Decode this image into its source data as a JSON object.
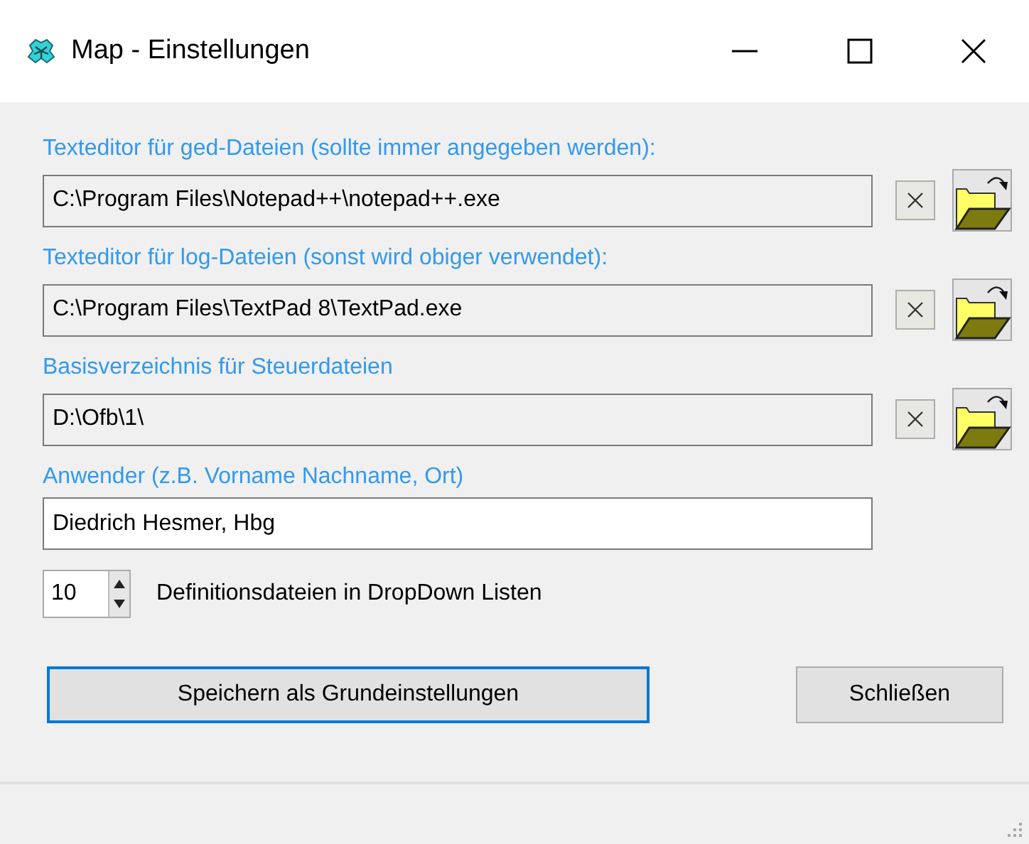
{
  "window": {
    "title": "Map - Einstellungen"
  },
  "path_fields": [
    {
      "label": "Texteditor für ged-Dateien (sollte immer angegeben werden):",
      "value": "C:\\Program Files\\Notepad++\\notepad++.exe",
      "readonly": true,
      "browse": true
    },
    {
      "label": "Texteditor für log-Dateien (sonst wird obiger verwendet):",
      "value": "C:\\Program Files\\TextPad 8\\TextPad.exe",
      "readonly": true,
      "browse": true
    },
    {
      "label": "Basisverzeichnis für Steuerdateien",
      "value": "D:\\Ofb\\1\\",
      "readonly": true,
      "browse": true
    },
    {
      "label": "Anwender (z.B. Vorname Nachname, Ort)",
      "value": "Diedrich Hesmer, Hbg",
      "readonly": false,
      "browse": false
    }
  ],
  "spinner": {
    "value": "10",
    "label": "Definitionsdateien in DropDown Listen"
  },
  "buttons": [
    {
      "label": "Speichern als Grundeinstellungen",
      "default": true
    },
    {
      "label": "Schließen",
      "default": false
    }
  ]
}
